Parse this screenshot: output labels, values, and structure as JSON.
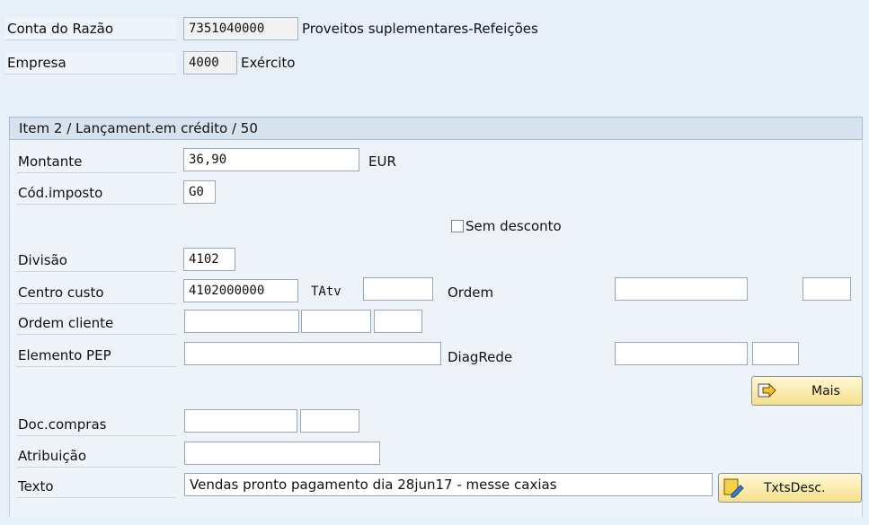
{
  "header": {
    "gl_account_label": "Conta do Razão",
    "gl_account_value": "7351040000",
    "gl_account_desc": "Proveitos suplementares-Refeições",
    "company_label": "Empresa",
    "company_value": "4000",
    "company_desc": "Exército"
  },
  "section_title": "Item 2 / Lançament.em crédito / 50",
  "form": {
    "amount_label": "Montante",
    "amount_value": "36,90",
    "currency": "EUR",
    "tax_code_label": "Cód.imposto",
    "tax_code_value": "G0",
    "no_discount_label": "Sem desconto",
    "no_discount_checked": false,
    "division_label": "Divisão",
    "division_value": "4102",
    "cost_center_label": "Centro custo",
    "cost_center_value": "4102000000",
    "tatv_label": "TAtv",
    "tatv_value": "",
    "order_label": "Ordem",
    "order_value": "",
    "order_extra_value": "",
    "customer_order_label": "Ordem cliente",
    "customer_order_value": "",
    "customer_order_item": "",
    "customer_order_sched": "",
    "wbs_label": "Elemento PEP",
    "wbs_value": "",
    "network_label": "DiagRede",
    "network_value": "",
    "network_op": "",
    "more_button": "Mais",
    "purchase_doc_label": "Doc.compras",
    "purchase_doc_value": "",
    "purchase_doc_item": "",
    "assignment_label": "Atribuição",
    "assignment_value": "",
    "text_label": "Texto",
    "text_value": "Vendas pronto pagamento dia 28jun17 - messe caxias",
    "long_text_button": "TxtsDesc."
  },
  "icons": {
    "more": "arrow-right-icon",
    "long_text": "note-pencil-icon"
  }
}
